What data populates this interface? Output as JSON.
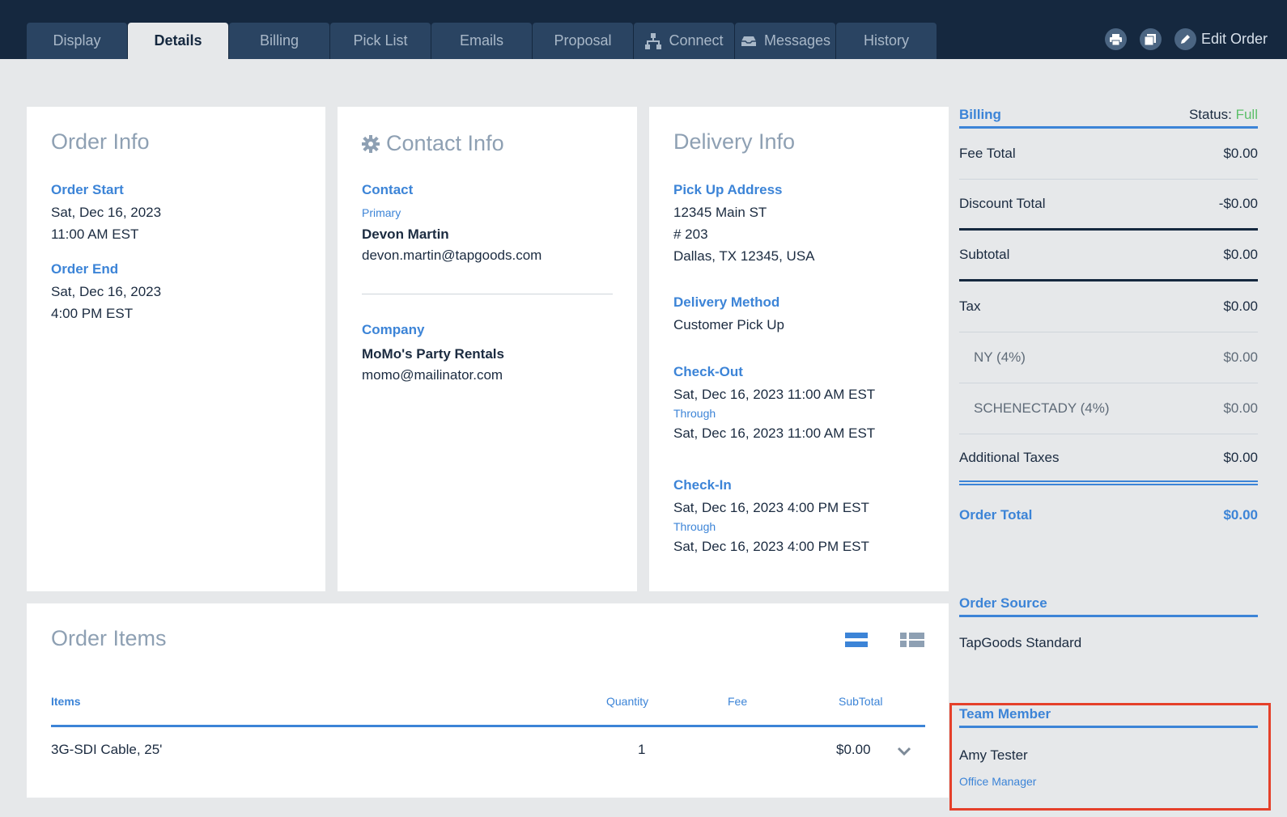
{
  "tabs": [
    {
      "label": "Display"
    },
    {
      "label": "Details"
    },
    {
      "label": "Billing"
    },
    {
      "label": "Pick List"
    },
    {
      "label": "Emails"
    },
    {
      "label": "Proposal"
    },
    {
      "label": "Connect"
    },
    {
      "label": "Messages"
    },
    {
      "label": "History"
    }
  ],
  "header": {
    "edit_order_label": "Edit Order"
  },
  "order_info": {
    "title": "Order Info",
    "start_label": "Order Start",
    "start_date": "Sat, Dec 16, 2023",
    "start_time": "11:00 AM EST",
    "end_label": "Order End",
    "end_date": "Sat, Dec 16, 2023",
    "end_time": "4:00 PM EST"
  },
  "contact_info": {
    "title": "Contact Info",
    "contact_label": "Contact",
    "primary_label": "Primary",
    "contact_name": "Devon Martin",
    "contact_email": "devon.martin@tapgoods.com",
    "company_label": "Company",
    "company_name": "MoMo's Party Rentals",
    "company_email": "momo@mailinator.com"
  },
  "delivery_info": {
    "title": "Delivery Info",
    "pickup_label": "Pick Up Address",
    "address_line1": "12345 Main ST",
    "address_line2": "# 203",
    "address_line3": "Dallas, TX 12345, USA",
    "method_label": "Delivery Method",
    "method_value": "Customer Pick Up",
    "checkout_label": "Check-Out",
    "checkout_from": "Sat, Dec 16, 2023 11:00 AM EST",
    "through_label_1": "Through",
    "checkout_to": "Sat, Dec 16, 2023 11:00 AM EST",
    "checkin_label": "Check-In",
    "checkin_from": "Sat, Dec 16, 2023 4:00 PM EST",
    "through_label_2": "Through",
    "checkin_to": "Sat, Dec 16, 2023 4:00 PM EST"
  },
  "billing": {
    "title": "Billing",
    "status_label": "Status:",
    "status_value": "Full",
    "status_color": "#5cbf6a",
    "rows": [
      {
        "label": "Fee Total",
        "value": "$0.00"
      },
      {
        "label": "Discount Total",
        "value": "-$0.00"
      },
      {
        "label": "Subtotal",
        "value": "$0.00"
      },
      {
        "label": "Tax",
        "value": "$0.00"
      },
      {
        "label": "NY (4%)",
        "value": "$0.00"
      },
      {
        "label": "SCHENECTADY (4%)",
        "value": "$0.00"
      },
      {
        "label": "Additional Taxes",
        "value": "$0.00"
      },
      {
        "label": "Order Total",
        "value": "$0.00"
      }
    ]
  },
  "order_source": {
    "title": "Order Source",
    "value": "TapGoods Standard"
  },
  "team_member": {
    "title": "Team Member",
    "name": "Amy Tester",
    "role": "Office Manager"
  },
  "order_items": {
    "title": "Order Items",
    "columns": {
      "items": "Items",
      "quantity": "Quantity",
      "fee": "Fee",
      "subtotal": "SubTotal"
    },
    "rows": [
      {
        "item": "3G-SDI Cable, 25'",
        "quantity": "1",
        "fee": "",
        "subtotal": "$0.00"
      }
    ]
  },
  "colors": {
    "accent": "#3c84d7",
    "navy": "#15283f",
    "highlight": "#e5402a"
  }
}
